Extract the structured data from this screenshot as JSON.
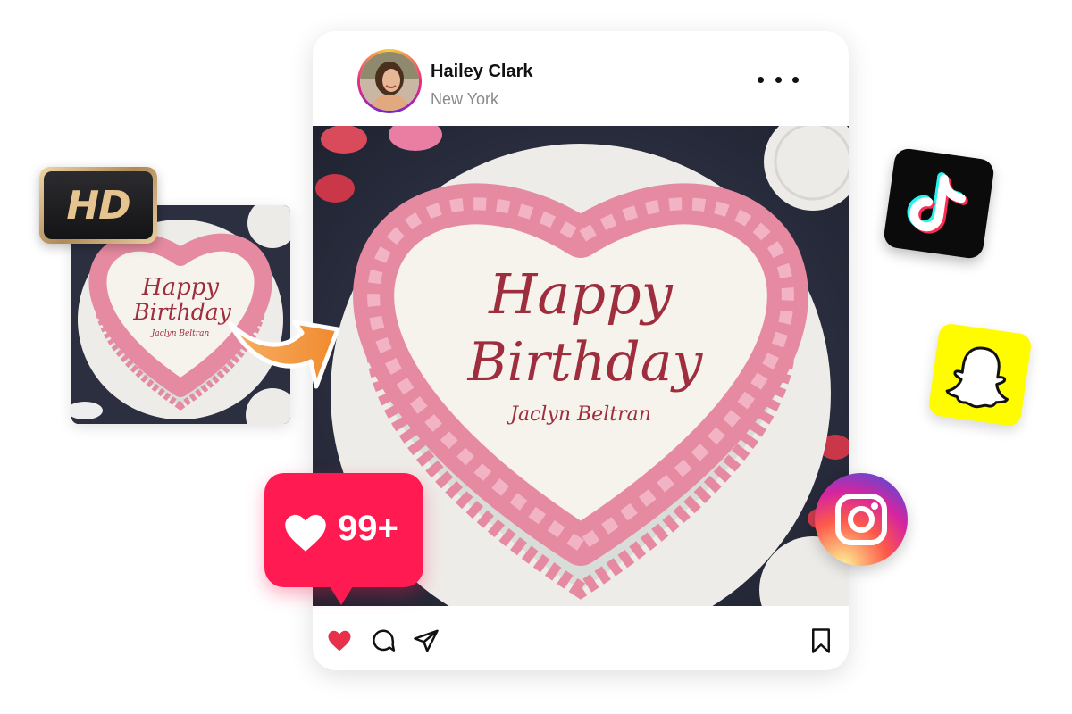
{
  "post": {
    "username": "Hailey Clark",
    "location": "New York",
    "image_text": {
      "line1": "Happy",
      "line2": "Birthday",
      "name": "Jaclyn Beltran"
    }
  },
  "thumbnail": {
    "badge": "HD",
    "image_text": {
      "line1": "Happy",
      "line2": "Birthday",
      "name": "Jaclyn Beltran"
    }
  },
  "likes": {
    "count": "99+"
  },
  "icons": {
    "more": "more-horizontal-icon",
    "like": "heart-icon",
    "comment": "comment-icon",
    "share": "send-icon",
    "save": "bookmark-icon",
    "apps": [
      "tiktok-icon",
      "snapchat-icon",
      "instagram-icon"
    ]
  },
  "colors": {
    "like_red": "#ff1a52",
    "heart": "#e8304a",
    "frosting": "#e58aa0",
    "lettering": "#9e2d3e"
  }
}
